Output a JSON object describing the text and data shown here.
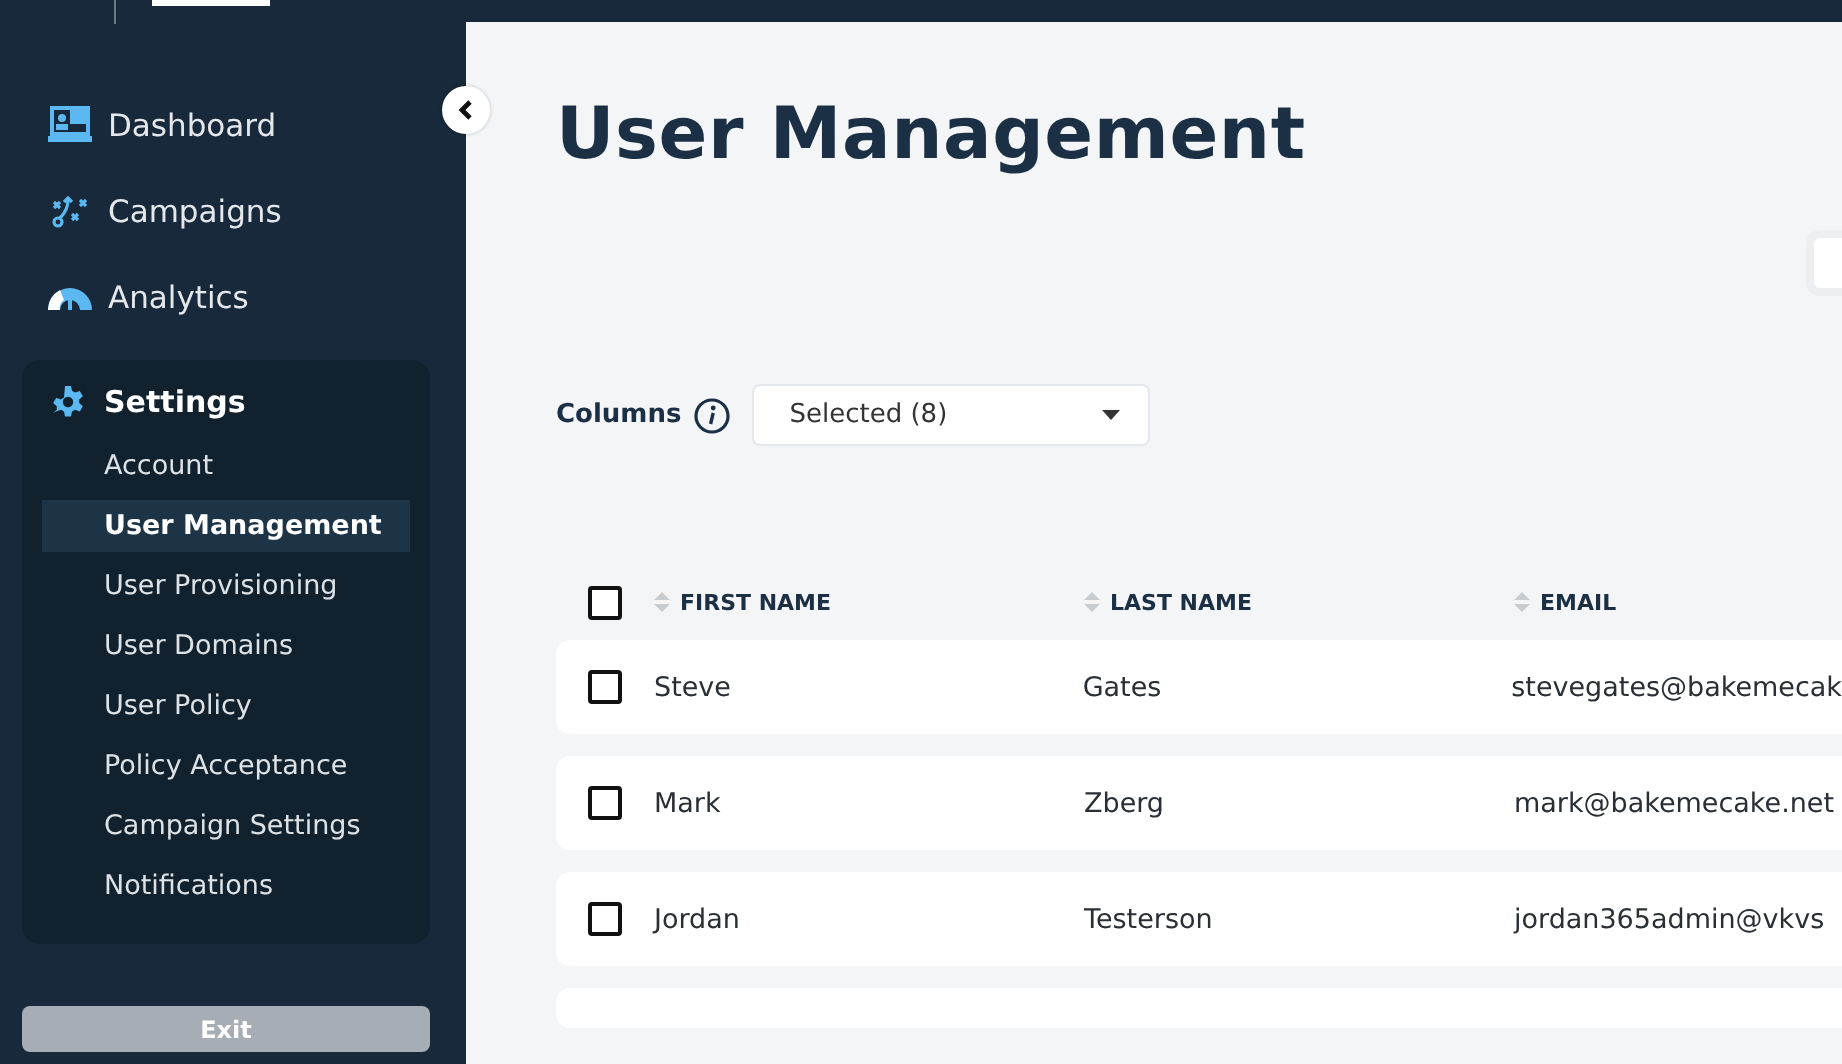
{
  "sidebar": {
    "nav": [
      {
        "label": "Dashboard"
      },
      {
        "label": "Campaigns"
      },
      {
        "label": "Analytics"
      }
    ],
    "settings": {
      "label": "Settings",
      "items": [
        {
          "label": "Account",
          "selected": false
        },
        {
          "label": "User Management",
          "selected": true
        },
        {
          "label": "User Provisioning",
          "selected": false
        },
        {
          "label": "User Domains",
          "selected": false
        },
        {
          "label": "User Policy",
          "selected": false
        },
        {
          "label": "Policy Acceptance",
          "selected": false
        },
        {
          "label": "Campaign Settings",
          "selected": false
        },
        {
          "label": "Notifications",
          "selected": false
        }
      ]
    },
    "exit_button": "Exit"
  },
  "page": {
    "title": "User Management",
    "columns_label": "Columns",
    "columns_select": "Selected (8)"
  },
  "table": {
    "all_checked": false,
    "columns": [
      "FIRST NAME",
      "LAST NAME",
      "EMAIL"
    ],
    "rows": [
      {
        "checked": false,
        "cells": [
          "Steve",
          "Gates",
          "stevegates@bakemecak"
        ]
      },
      {
        "checked": false,
        "cells": [
          "Mark",
          "Zberg",
          "mark@bakemecake.net"
        ]
      },
      {
        "checked": false,
        "cells": [
          "Jordan",
          "Testerson",
          "jordan365admin@vkvs"
        ]
      }
    ]
  }
}
